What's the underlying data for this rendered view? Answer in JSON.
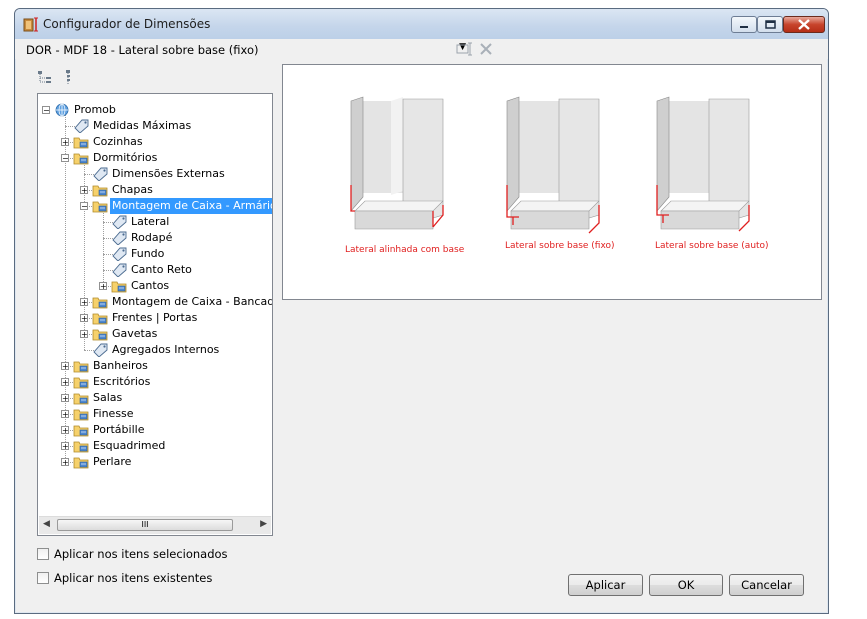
{
  "window": {
    "title": "Configurador de Dimensões"
  },
  "config": {
    "selected": "DOR - MDF 18 - Lateral sobre base (fixo)"
  },
  "tree": {
    "items": [
      {
        "label": "Promob",
        "level": 0,
        "icon": "globe-icon",
        "expander": "minus"
      },
      {
        "label": "Medidas Máximas",
        "level": 1,
        "icon": "tag-icon",
        "expander": ""
      },
      {
        "label": "Cozinhas",
        "level": 1,
        "icon": "folder-icon",
        "expander": "plus"
      },
      {
        "label": "Dormitórios",
        "level": 1,
        "icon": "folder-icon",
        "expander": "minus"
      },
      {
        "label": "Dimensões Externas",
        "level": 2,
        "icon": "tag-icon",
        "expander": ""
      },
      {
        "label": "Chapas",
        "level": 2,
        "icon": "folder-icon",
        "expander": "plus"
      },
      {
        "label": "Montagem de Caixa - Armários",
        "level": 2,
        "icon": "folder-icon",
        "expander": "minus",
        "selected": true
      },
      {
        "label": "Lateral",
        "level": 3,
        "icon": "tag-icon",
        "expander": ""
      },
      {
        "label": "Rodapé",
        "level": 3,
        "icon": "tag-icon",
        "expander": ""
      },
      {
        "label": "Fundo",
        "level": 3,
        "icon": "tag-icon",
        "expander": ""
      },
      {
        "label": "Canto Reto",
        "level": 3,
        "icon": "tag-icon",
        "expander": ""
      },
      {
        "label": "Cantos",
        "level": 3,
        "icon": "folder-icon",
        "expander": "plus"
      },
      {
        "label": "Montagem de Caixa - Bancadas",
        "level": 2,
        "icon": "folder-icon",
        "expander": "plus"
      },
      {
        "label": "Frentes | Portas",
        "level": 2,
        "icon": "folder-icon",
        "expander": "plus"
      },
      {
        "label": "Gavetas",
        "level": 2,
        "icon": "folder-icon",
        "expander": "plus"
      },
      {
        "label": "Agregados Internos",
        "level": 2,
        "icon": "tag-icon",
        "expander": ""
      },
      {
        "label": "Banheiros",
        "level": 1,
        "icon": "folder-icon",
        "expander": "plus"
      },
      {
        "label": "Escritórios",
        "level": 1,
        "icon": "folder-icon",
        "expander": "plus"
      },
      {
        "label": "Salas",
        "level": 1,
        "icon": "folder-icon",
        "expander": "plus"
      },
      {
        "label": "Finesse",
        "level": 1,
        "icon": "folder-icon",
        "expander": "plus"
      },
      {
        "label": "Portábille",
        "level": 1,
        "icon": "folder-icon",
        "expander": "plus"
      },
      {
        "label": "Esquadrimed",
        "level": 1,
        "icon": "folder-icon",
        "expander": "plus"
      },
      {
        "label": "Perlare",
        "level": 1,
        "icon": "folder-icon",
        "expander": "plus"
      }
    ],
    "scroll_thumb": "III"
  },
  "preview": {
    "captions": [
      "Lateral alinhada com base",
      "Lateral sobre base (fixo)",
      "Lateral sobre base (auto)"
    ],
    "caption_color": "#e02020"
  },
  "options": {
    "apply_selected": "Aplicar nos itens selecionados",
    "apply_existing": "Aplicar nos itens existentes"
  },
  "buttons": {
    "apply": "Aplicar",
    "ok": "OK",
    "cancel": "Cancelar"
  }
}
